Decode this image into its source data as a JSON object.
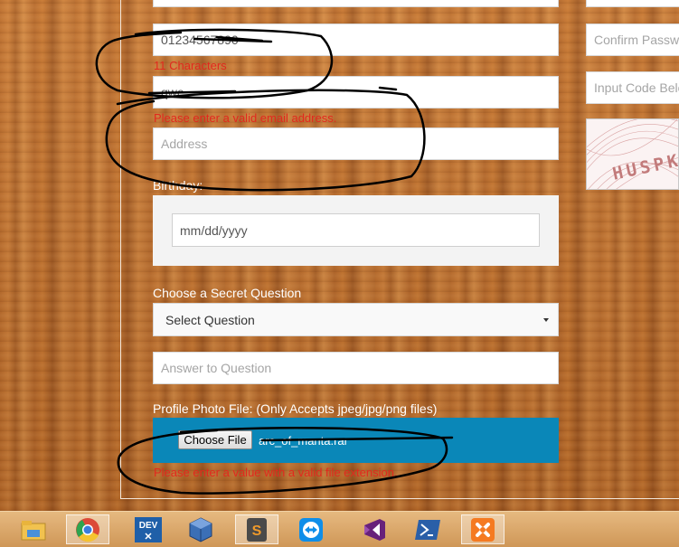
{
  "form": {
    "phone_value": "01234567890",
    "phone_error": "11 Characters",
    "email_value": "qwe",
    "email_error": "Please enter a valid email address.",
    "address_placeholder": "Address",
    "birthday_label": "Birthday:",
    "birthday_placeholder": "mm/dd/yyyy",
    "secret_question_label": "Choose a Secret Question",
    "secret_question_selected": "Select Question",
    "answer_placeholder": "Answer to Question",
    "photo_label": "Profile Photo File: (Only Accepts jpeg/jpg/png files)",
    "choose_file_label": "Choose File",
    "chosen_file_name": "arc_of_manta.rar",
    "file_error": "Please enter a value with a valid file extension."
  },
  "right_column": {
    "confirm_password_placeholder": "Confirm Password",
    "captcha_input_placeholder": "Input Code Below",
    "captcha_text": "HUSPK"
  },
  "taskbar": {
    "apps": [
      {
        "name": "file-explorer-icon",
        "color": "#f1c24f"
      },
      {
        "name": "chrome-icon",
        "color": "#dc4a38"
      },
      {
        "name": "devexpress-icon",
        "color": "#1f5fa8",
        "text": "DEV"
      },
      {
        "name": "virtualbox-icon",
        "color": "#3b6fb6"
      },
      {
        "name": "sublime-text-icon",
        "color": "#f09a2a",
        "text": "S"
      },
      {
        "name": "teamviewer-icon",
        "color": "#0e8ee9"
      },
      {
        "name": "visual-studio-icon",
        "color": "#68217a"
      },
      {
        "name": "powershell-icon",
        "color": "#2a5fa8"
      },
      {
        "name": "xampp-icon",
        "color": "#f57a21"
      }
    ]
  }
}
